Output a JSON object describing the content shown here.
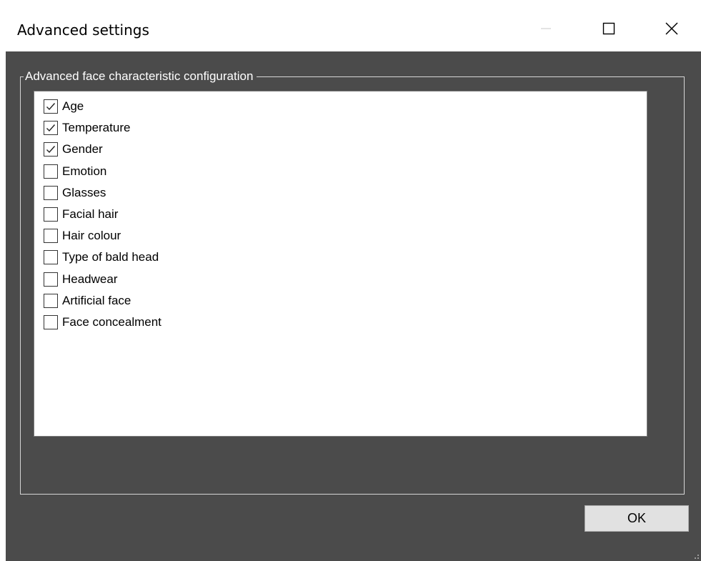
{
  "window": {
    "title": "Advanced settings",
    "controls": {
      "minimize": "minimize-icon",
      "maximize": "maximize-icon",
      "close": "close-icon"
    }
  },
  "group": {
    "legend": "Advanced face characteristic configuration"
  },
  "items": [
    {
      "label": "Age",
      "checked": true
    },
    {
      "label": "Temperature",
      "checked": true
    },
    {
      "label": "Gender",
      "checked": true
    },
    {
      "label": "Emotion",
      "checked": false
    },
    {
      "label": "Glasses",
      "checked": false
    },
    {
      "label": "Facial hair",
      "checked": false
    },
    {
      "label": "Hair colour",
      "checked": false
    },
    {
      "label": "Type of bald head",
      "checked": false
    },
    {
      "label": "Headwear",
      "checked": false
    },
    {
      "label": "Artificial face",
      "checked": false
    },
    {
      "label": "Face concealment",
      "checked": false
    }
  ],
  "buttons": {
    "ok": "OK"
  },
  "colors": {
    "dialog_background": "#4b4b4b",
    "titlebar": "#ffffff",
    "list_background": "#ffffff",
    "button_face": "#e1e1e1"
  }
}
